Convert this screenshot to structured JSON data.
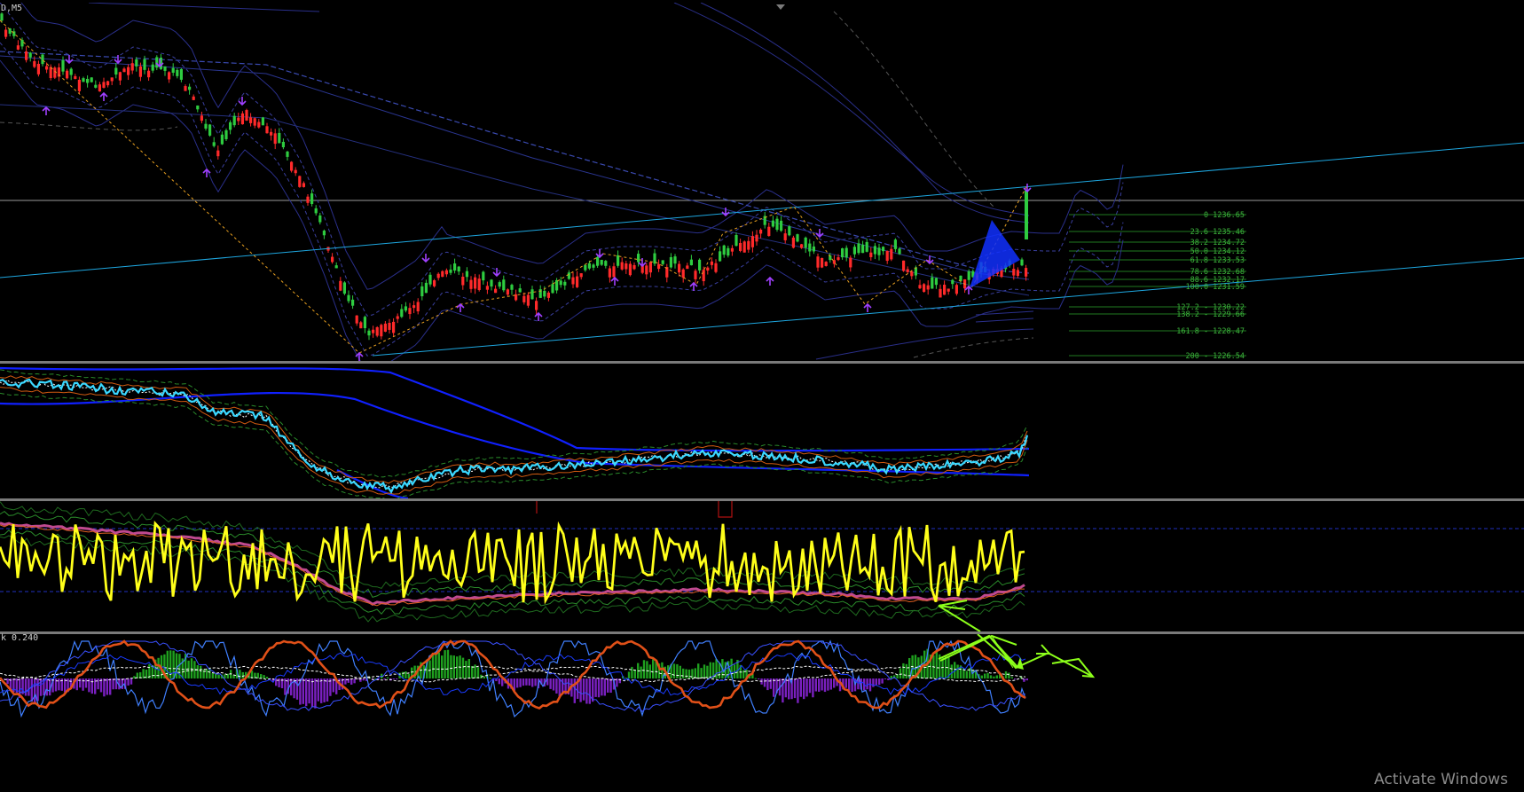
{
  "chart": {
    "symbol_label": "D,M5",
    "indicator_label": "k 0.240"
  },
  "fibonacci": [
    {
      "label": "0 1236.65"
    },
    {
      "label": "23.6 1235.46"
    },
    {
      "label": "38.2 1234.72"
    },
    {
      "label": "50.0 1234.12"
    },
    {
      "label": "61.8 1233.53"
    },
    {
      "label": "78.6 1232.68"
    },
    {
      "label": "88.6 1232.17"
    },
    {
      "label": "100.0 1231.59"
    },
    {
      "label": "127.2 - 1230.22"
    },
    {
      "label": "138.2 - 1229.66"
    },
    {
      "label": "161.8 - 1228.47"
    },
    {
      "label": "200 - 1226.54"
    }
  ],
  "colors": {
    "bull_candle": "#2ecc40",
    "bear_candle": "#ff2a2a",
    "fib_lines": "#1f7a1f",
    "fib_text": "#3cb43c",
    "channel": "#1ea7e0",
    "oscillator": "#ffff1a",
    "fast_line": "#3ad8ff",
    "slow_line": "#1020ff",
    "arrow_marker": "#a040ff",
    "annotation": "#8cff1a"
  },
  "watermark": "Activate Windows"
}
